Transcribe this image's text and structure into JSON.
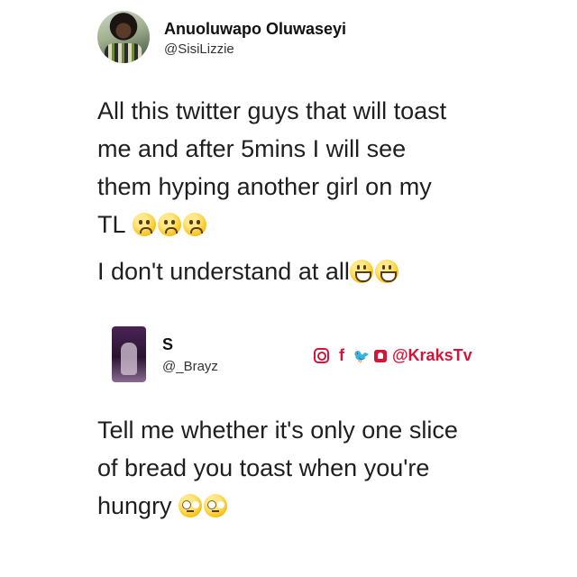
{
  "original_tweet": {
    "name": "Anuoluwapo Oluwaseyi",
    "handle": "@SisiLizzie",
    "lines": [
      "All this twitter guys that will toast",
      "me and after 5mins I will see",
      "them hyping another girl on my",
      "TL"
    ],
    "line2": "I don't understand at all",
    "emojis_line1": [
      "sad-tear-face-icon",
      "sad-tear-face-icon",
      "sad-tear-face-icon"
    ],
    "emojis_line2": [
      "grinning-face-icon",
      "grinning-face-icon"
    ]
  },
  "reply_tweet": {
    "name": "S",
    "handle": "@_Brayz",
    "lines": [
      "Tell me whether it's only one slice",
      "of bread you toast when you're",
      "hungry"
    ],
    "emojis": [
      "eye-roll-face-icon",
      "eye-roll-face-icon"
    ]
  },
  "credit": {
    "handle": "@KraksTv",
    "icons": [
      "instagram-icon",
      "facebook-icon",
      "twitter-icon",
      "snapchat-icon"
    ],
    "color": "#d2163a"
  }
}
